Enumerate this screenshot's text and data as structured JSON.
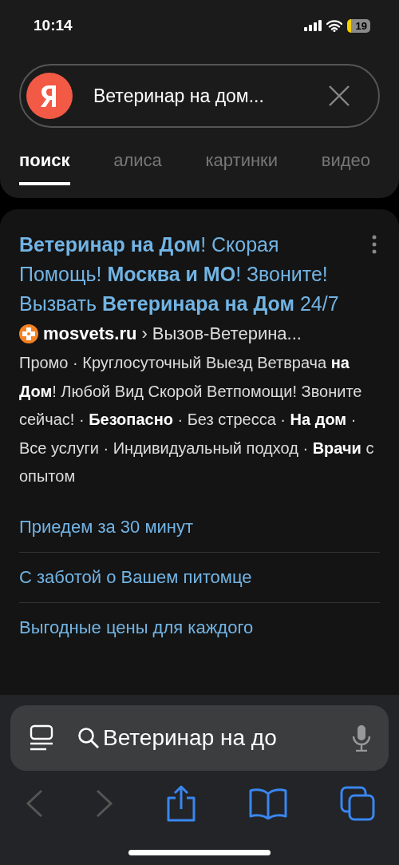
{
  "status_bar": {
    "time": "10:14",
    "battery": "19"
  },
  "search": {
    "value": "Ветеринар на дом..."
  },
  "tabs": [
    {
      "label": "поиск",
      "selected": true
    },
    {
      "label": "алиса",
      "selected": false
    },
    {
      "label": "картинки",
      "selected": false
    },
    {
      "label": "видео",
      "selected": false
    }
  ],
  "result": {
    "title": "**Ветеринар на Дом**! Скорая Помощь! **Москва и МО**! Звоните! Вызвать **Ветеринара на Дом** 24/7",
    "site": "mosvets.ru",
    "path": "› Вызов-Ветерина...",
    "snippet": "Промо · Круглосуточный Выезд Ветврача **на Дом**! Любой Вид Скорой Ветпомощи! Звоните сейчас! · **Безопасно** · Без стресса · **На дом** · Все услуги · Индивидуальный подход · **Врачи** с опытом",
    "sitelinks": [
      "Приедем за 30 минут",
      "С заботой о Вашем питомце",
      "Выгодные цены для каждого"
    ]
  },
  "address_bar": {
    "value": "Ветеринар на до"
  }
}
